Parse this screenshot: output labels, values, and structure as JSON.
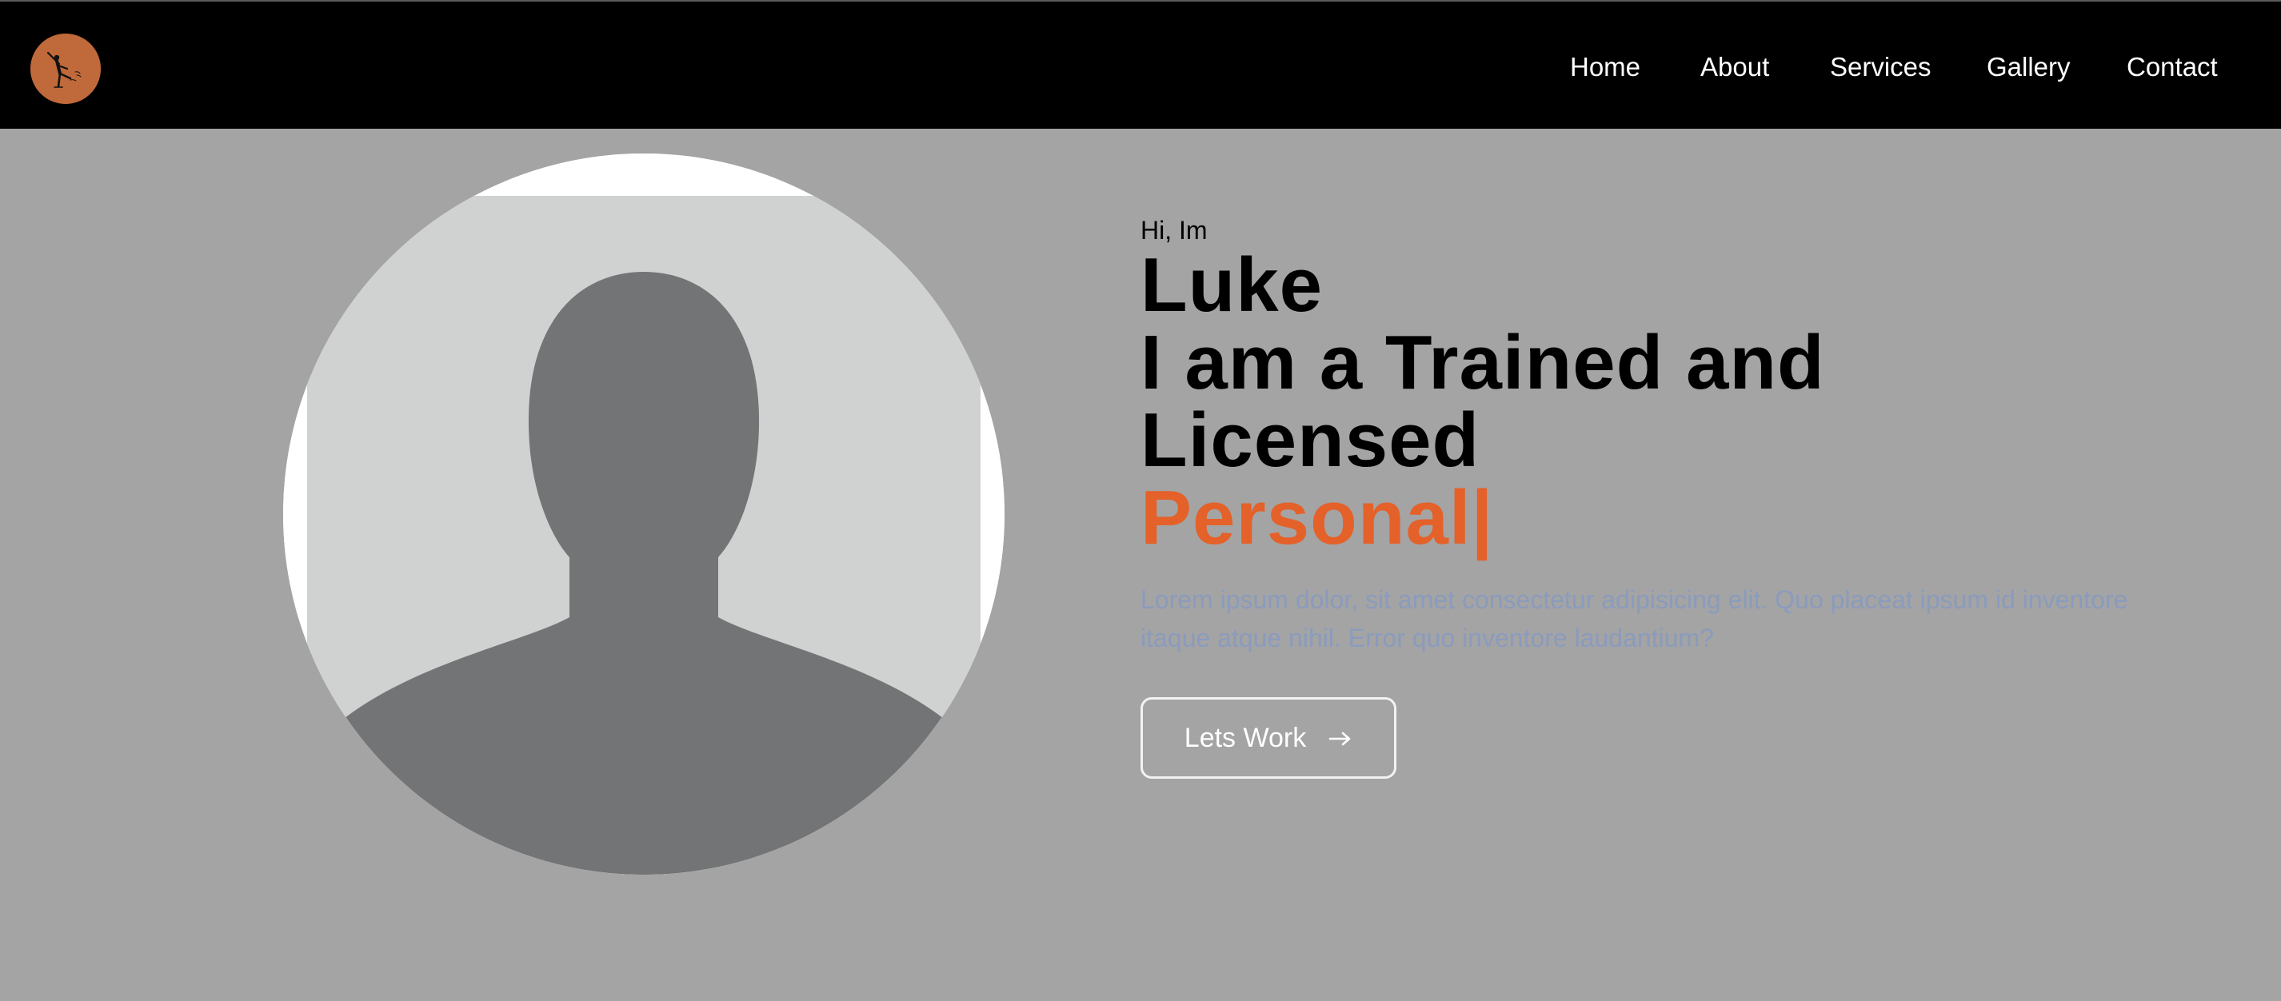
{
  "nav": {
    "logo_icon": "dancer-logo-icon",
    "links": [
      "Home",
      "About",
      "Services",
      "Gallery",
      "Contact"
    ]
  },
  "hero": {
    "greeting": "Hi, Im",
    "name": "Luke",
    "headline_line1": "I am a Trained and",
    "headline_line2": "Licensed",
    "typed_word": "Personal|",
    "description": "Lorem ipsum dolor, sit amet consectetur adipisicing elit. Quo placeat ipsum id inventore itaque atque nihil. Error quo inventore laudantium?",
    "cta_label": "Lets Work",
    "cta_icon": "arrow-right-icon",
    "portrait_icon": "profile-placeholder-icon"
  },
  "colors": {
    "navbar": "#000000",
    "page_background": "#a4a4a4",
    "accent": "#e4612a",
    "logo_background": "#c0693a",
    "description_text": "#8a9bbd"
  }
}
